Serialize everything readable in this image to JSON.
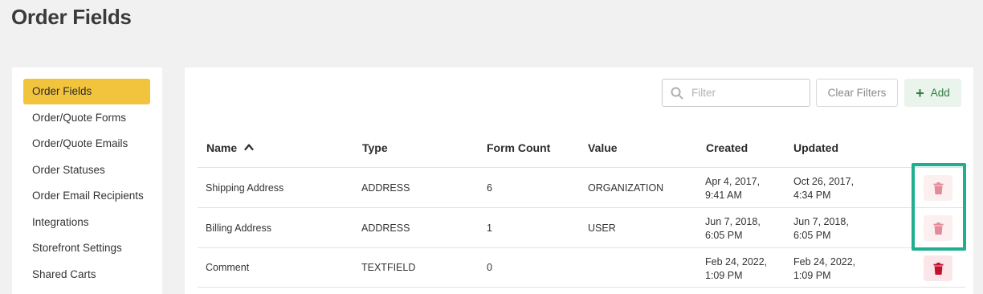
{
  "page": {
    "title": "Order Fields"
  },
  "sidebar": {
    "items": [
      {
        "label": "Order Fields",
        "active": true
      },
      {
        "label": "Order/Quote Forms",
        "active": false
      },
      {
        "label": "Order/Quote Emails",
        "active": false
      },
      {
        "label": "Order Statuses",
        "active": false
      },
      {
        "label": "Order Email Recipients",
        "active": false
      },
      {
        "label": "Integrations",
        "active": false
      },
      {
        "label": "Storefront Settings",
        "active": false
      },
      {
        "label": "Shared Carts",
        "active": false
      }
    ]
  },
  "toolbar": {
    "filter_placeholder": "Filter",
    "filter_value": "",
    "clear_label": "Clear Filters",
    "add_label": "Add"
  },
  "table": {
    "columns": {
      "name": "Name",
      "type": "Type",
      "form_count": "Form Count",
      "value": "Value",
      "created": "Created",
      "updated": "Updated"
    },
    "sort": {
      "column": "Name",
      "direction": "ascending"
    },
    "rows": [
      {
        "name": "Shipping Address",
        "type": "ADDRESS",
        "form_count": "6",
        "value": "ORGANIZATION",
        "created": "Apr 4, 2017,\n9:41 AM",
        "updated": "Oct 26, 2017,\n4:34 PM",
        "delete_state": "disabled"
      },
      {
        "name": "Billing Address",
        "type": "ADDRESS",
        "form_count": "1",
        "value": "USER",
        "created": "Jun 7, 2018,\n6:05 PM",
        "updated": "Jun 7, 2018,\n6:05 PM",
        "delete_state": "disabled"
      },
      {
        "name": "Comment",
        "type": "TEXTFIELD",
        "form_count": "0",
        "value": "",
        "created": "Feb 24, 2022,\n1:09 PM",
        "updated": "Feb 24, 2022,\n1:09 PM",
        "delete_state": "enabled"
      }
    ]
  },
  "colors": {
    "active_nav": "#f2c43d",
    "add_green": "#2e7d3d",
    "trash_faded": "#e58a98",
    "trash_solid": "#c8102e",
    "highlight": "#1fae8e"
  },
  "icons": [
    "search-icon",
    "plus-icon",
    "sort-ascending-icon",
    "trash-icon"
  ]
}
